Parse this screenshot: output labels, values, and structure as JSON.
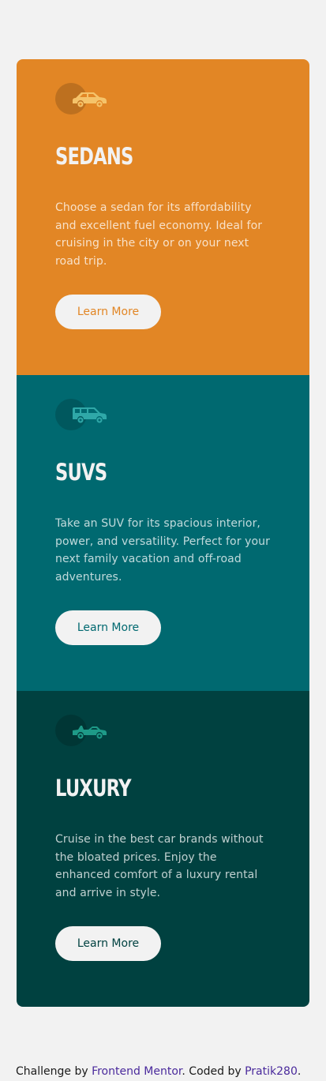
{
  "cards": [
    {
      "id": "sedans",
      "icon": "sedan-car-icon",
      "title": "Sedans",
      "text": "Choose a sedan for its affordability and excellent fuel economy. Ideal for cruising in the city or on your next road trip.",
      "button_label": "Learn More",
      "color": "#E28625"
    },
    {
      "id": "suvs",
      "icon": "suv-car-icon",
      "title": "SUVs",
      "text": "Take an SUV for its spacious interior, power, and versatility. Perfect for your next family vacation and off-road adventures.",
      "button_label": "Learn More",
      "color": "#006970"
    },
    {
      "id": "luxury",
      "icon": "luxury-car-icon",
      "title": "Luxury",
      "text": "Cruise in the best car brands without the bloated prices. Enjoy the enhanced comfort of a luxury rental and arrive in style.",
      "button_label": "Learn More",
      "color": "#004140"
    }
  ],
  "attribution": {
    "prefix": "Challenge by ",
    "challenge_link": "Frontend Mentor",
    "middle": ". Coded by ",
    "author_link": "Pratik280",
    "suffix": "."
  },
  "colors": {
    "background": "#F2F2F2",
    "sedans_icon": "#F5C36A",
    "suvs_icon": "#2FA8A8",
    "luxury_icon": "#1E9A88",
    "link": "#4A2A9C"
  }
}
